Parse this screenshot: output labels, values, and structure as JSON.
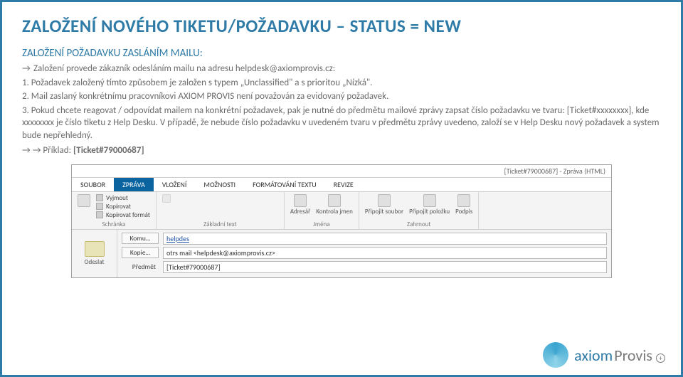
{
  "title": "ZALOŽENÍ NOVÉHO TIKETU/POŽADAVKU – STATUS = NEW",
  "subtitle": "ZALOŽENÍ POŽADAVKU ZASLÁNÍM MAILU:",
  "arrow": "→",
  "body": {
    "intro": "Založení provede zákazník odesláním mailu na adresu helpdesk@axiomprovis.cz:",
    "p1": "1. Požadavek založený tímto způsobem je založen s typem „Unclassified\" a s prioritou „Nízká\".",
    "p2": "2. Mail zaslaný konkrétnímu pracovníkovi AXIOM PROVIS není považován za evidovaný požadavek.",
    "p3": "3. Pokud chcete reagovat / odpovídat mailem na konkrétní požadavek, pak je nutné do předmětu mailové zprávy zapsat číslo požadavku ve tvaru: [Ticket#xxxxxxxx], kde xxxxxxxx je číslo tiketu z Help Desku. V případě, že nebude číslo požadavku v uvedeném tvaru v předmětu zprávy uvedeno, založí se v Help Desku nový požadavek a system bude nepřehledný.",
    "example_label": "→ → Příklad:",
    "example_value": "[Ticket#79000687]"
  },
  "outlook": {
    "window_title": "[Ticket#79000687] - Zpráva (HTML)",
    "tabs": [
      "SOUBOR",
      "ZPRÁVA",
      "VLOŽENÍ",
      "MOŽNOSTI",
      "FORMÁTOVÁNÍ TEXTU",
      "REVIZE"
    ],
    "active_tab": "ZPRÁVA",
    "groups": {
      "schranka": {
        "label": "Schránka",
        "items": [
          "Vyjmout",
          "Kopírovat",
          "Kopírovat formát"
        ]
      },
      "zakladni": {
        "label": "Základní text"
      },
      "jmena": {
        "label": "Jména",
        "items": [
          "Adresář",
          "Kontrola jmen"
        ]
      },
      "zahrnout": {
        "label": "Zahrnout",
        "items": [
          "Připojit soubor",
          "Připojit položku",
          "Podpis"
        ]
      }
    },
    "send_label": "Odeslat",
    "fields": {
      "to_label": "Komu…",
      "to_value": "helpdes",
      "cc_label": "Kopie…",
      "cc_value": "otrs mail <helpdesk@axiomprovis.cz>",
      "subject_label": "Předmět",
      "subject_value": "[Ticket#79000687]"
    }
  },
  "logo": {
    "part1": "axiom",
    "part2": "Provis",
    "sup": "+"
  }
}
